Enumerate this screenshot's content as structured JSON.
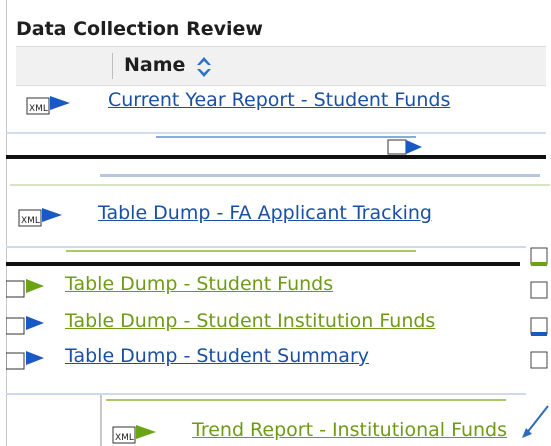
{
  "panel": {
    "title": "Data Collection Review"
  },
  "table": {
    "header": {
      "name": "Name"
    },
    "rows": [
      {
        "label": "Current Year Report - Student Funds",
        "color": "#1a4fa3"
      },
      {
        "label": "Table Dump - FA Applicant Tracking",
        "color": "#1a4fa3"
      },
      {
        "label": "Table Dump - Student Funds",
        "color": "#6f9a18"
      },
      {
        "label": "Table Dump - Student Institution Funds",
        "color": "#6f9a18"
      },
      {
        "label": "Table Dump - Student Summary",
        "color": "#1a4fa3"
      },
      {
        "label": "Trend Report - Institutional Funds",
        "color": "#6f9a18"
      }
    ]
  }
}
